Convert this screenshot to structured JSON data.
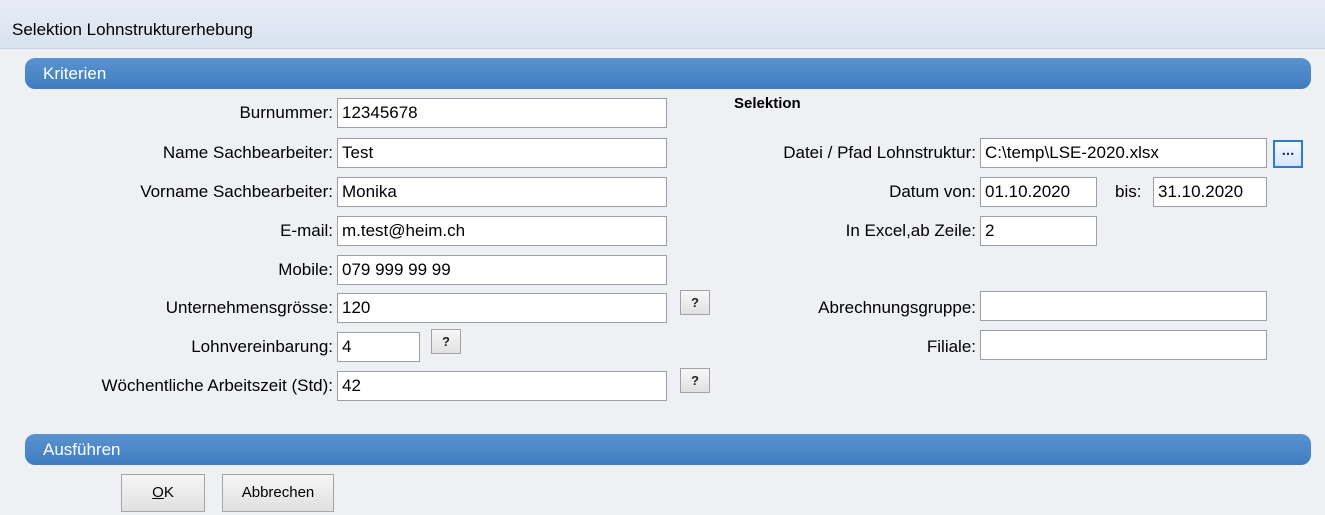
{
  "window": {
    "title": "Selektion Lohnstrukturerhebung"
  },
  "sections": {
    "criteria": "Kriterien",
    "execute": "Ausführen"
  },
  "left": {
    "burnummer": {
      "label": "Burnummer:",
      "value": "12345678"
    },
    "name": {
      "label": "Name Sachbearbeiter:",
      "value": "Test"
    },
    "vorname": {
      "label": "Vorname Sachbearbeiter:",
      "value": "Monika"
    },
    "email": {
      "label": "E-mail:",
      "value": "m.test@heim.ch"
    },
    "mobile": {
      "label": "Mobile:",
      "value": "079 999 99 99"
    },
    "groesse": {
      "label": "Unternehmensgrösse:",
      "value": "120",
      "help": "?"
    },
    "lohnvereinbarung": {
      "label": "Lohnvereinbarung:",
      "value": "4",
      "help": "?"
    },
    "arbeitszeit": {
      "label": "Wöchentliche Arbeitszeit (Std):",
      "value": "42",
      "help": "?"
    }
  },
  "right": {
    "heading": "Selektion",
    "datei": {
      "label": "Datei / Pfad Lohnstruktur:",
      "value": "C:\\temp\\LSE-2020.xlsx",
      "browse": "..."
    },
    "datum_von": {
      "label": "Datum von:",
      "value": "01.10.2020"
    },
    "datum_bis": {
      "label": "bis:",
      "value": "31.10.2020"
    },
    "ab_zeile": {
      "label": "In Excel,ab Zeile:",
      "value": "2"
    },
    "abrechnungsgruppe": {
      "label": "Abrechnungsgruppe:",
      "value": ""
    },
    "filiale": {
      "label": "Filiale:",
      "value": ""
    }
  },
  "buttons": {
    "ok_mnemonic": "O",
    "ok_rest": "K",
    "cancel": "Abbrechen"
  }
}
